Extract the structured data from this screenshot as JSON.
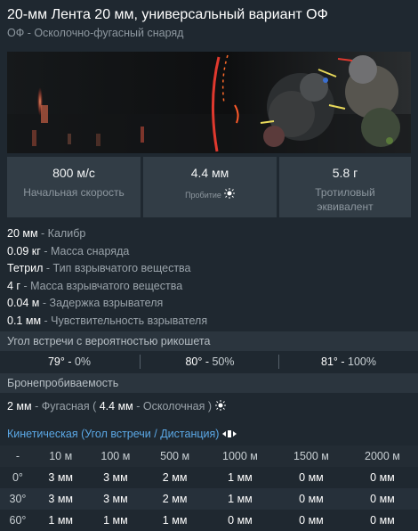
{
  "header": {
    "title": "20-мм Лента 20 мм, универсальный вариант ОФ",
    "subtitle": "ОФ - Осколочно-фугасный снаряд"
  },
  "stats": [
    {
      "value": "800 м/с",
      "label": "Начальная скорость"
    },
    {
      "value": "4.4 мм",
      "label": "Пробитие"
    },
    {
      "value": "5.8 г",
      "label": "Тротиловый эквивалент"
    }
  ],
  "properties": [
    {
      "value": "20 мм",
      "label": " - Калибр"
    },
    {
      "value": "0.09 кг",
      "label": " - Масса снаряда"
    },
    {
      "value": "Тетрил",
      "label": " - Тип взрывчатого вещества"
    },
    {
      "value": "4 г",
      "label": " - Масса взрывчатого вещества"
    },
    {
      "value": "0.04 м",
      "label": " - Задержка взрывателя"
    },
    {
      "value": "0.1 мм",
      "label": " - Чувствительность взрывателя"
    }
  ],
  "ricochet": {
    "title": "Угол встречи с вероятностью рикошета",
    "cells": [
      {
        "angle": "79°",
        "pct": "0%"
      },
      {
        "angle": "80°",
        "pct": "50%"
      },
      {
        "angle": "81°",
        "pct": "100%"
      }
    ]
  },
  "penetration": {
    "title": "Бронепробиваемость",
    "he_value": "2 мм",
    "he_label": "Фугасная",
    "frag_value": "4.4 мм",
    "frag_label": "Осколочная"
  },
  "kinetic": {
    "title": "Кинетическая (Угол встречи / Дистанция)",
    "headers": [
      "-",
      "10 м",
      "100 м",
      "500 м",
      "1000 м",
      "1500 м",
      "2000 м"
    ],
    "rows": [
      {
        "angle": "0°",
        "values": [
          "3 мм",
          "3 мм",
          "2 мм",
          "1 мм",
          "0 мм",
          "0 мм"
        ]
      },
      {
        "angle": "30°",
        "values": [
          "3 мм",
          "3 мм",
          "2 мм",
          "1 мм",
          "0 мм",
          "0 мм"
        ]
      },
      {
        "angle": "60°",
        "values": [
          "1 мм",
          "1 мм",
          "1 мм",
          "0 мм",
          "0 мм",
          "0 мм"
        ]
      }
    ]
  },
  "icons": {
    "explosion": "explosion-icon",
    "distance": "distance-arrows-icon"
  }
}
